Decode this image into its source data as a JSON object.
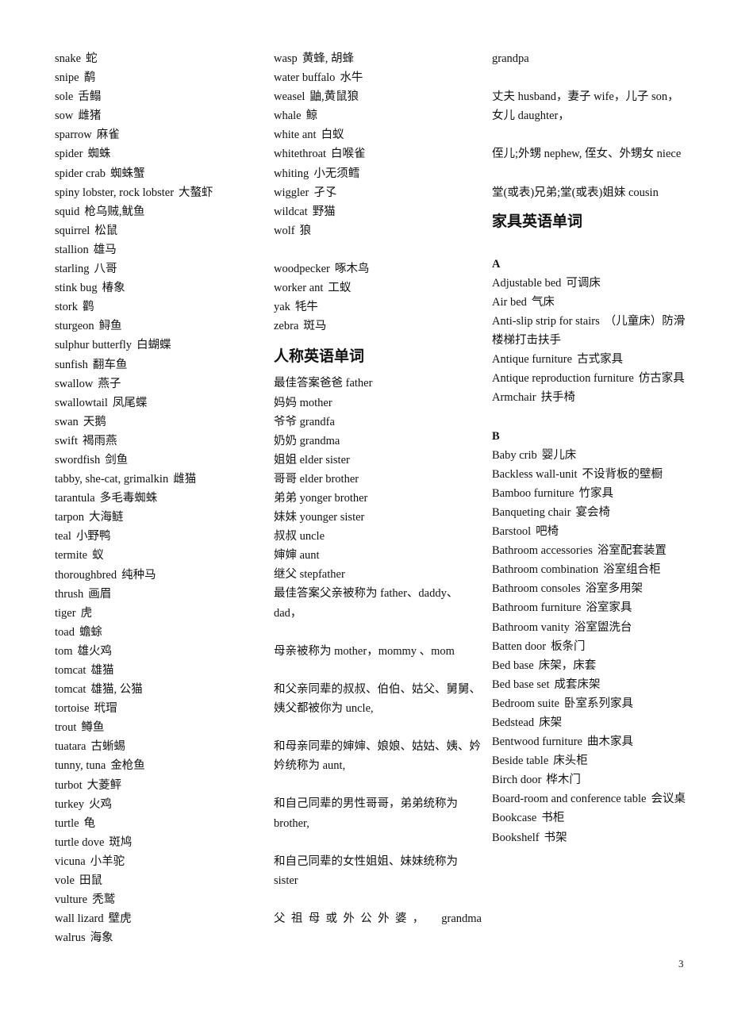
{
  "left_column": [
    {
      "en": "snake",
      "zh": "蛇"
    },
    {
      "en": "snipe",
      "zh": "鹬"
    },
    {
      "en": "sole",
      "zh": "舌鳎"
    },
    {
      "en": "sow",
      "zh": "雌猪"
    },
    {
      "en": "sparrow",
      "zh": "麻雀"
    },
    {
      "en": "spider",
      "zh": "蜘蛛"
    },
    {
      "en": "spider crab",
      "zh": "蜘蛛蟹"
    },
    {
      "en": "spiny lobster, rock lobster",
      "zh": "大螯虾"
    },
    {
      "en": "squid",
      "zh": "枪乌贼,鱿鱼"
    },
    {
      "en": "squirrel",
      "zh": "松鼠"
    },
    {
      "en": "stallion",
      "zh": "雄马"
    },
    {
      "en": "starling",
      "zh": "八哥"
    },
    {
      "en": "stink bug",
      "zh": "椿象"
    },
    {
      "en": "stork",
      "zh": "鹳"
    },
    {
      "en": "sturgeon",
      "zh": "鲟鱼"
    },
    {
      "en": "sulphur butterfly",
      "zh": "白蝴蝶"
    },
    {
      "en": "sunfish",
      "zh": "翻车鱼"
    },
    {
      "en": "swallow",
      "zh": "燕子"
    },
    {
      "en": "swallowtail",
      "zh": "凤尾蝶"
    },
    {
      "en": "swan",
      "zh": "天鹅"
    },
    {
      "en": "swift",
      "zh": "褐雨燕"
    },
    {
      "en": "swordfish",
      "zh": "剑鱼"
    },
    {
      "en": "tabby, she-cat, grimalkin",
      "zh": "雌猫"
    },
    {
      "en": "tarantula",
      "zh": "多毛毒蜘蛛"
    },
    {
      "en": "tarpon",
      "zh": "大海鲢"
    },
    {
      "en": "teal",
      "zh": "小野鸭"
    },
    {
      "en": "termite",
      "zh": "蚁"
    },
    {
      "en": "thoroughbred",
      "zh": "纯种马"
    },
    {
      "en": "thrush",
      "zh": "画眉"
    },
    {
      "en": "tiger",
      "zh": "虎"
    },
    {
      "en": "toad",
      "zh": "蟾蜍"
    },
    {
      "en": "tom",
      "zh": "雄火鸡"
    },
    {
      "en": "tomcat",
      "zh": "雄猫"
    },
    {
      "en": "tomcat",
      "zh": "雄猫, 公猫"
    },
    {
      "en": "tortoise",
      "zh": "玳瑁"
    },
    {
      "en": "trout",
      "zh": "鳟鱼"
    },
    {
      "en": "tuatara",
      "zh": "古蜥蜴"
    },
    {
      "en": "tunny, tuna",
      "zh": "金枪鱼"
    },
    {
      "en": "turbot",
      "zh": "大菱鲆"
    },
    {
      "en": "turkey",
      "zh": "火鸡"
    },
    {
      "en": "turtle",
      "zh": "龟"
    },
    {
      "en": "turtle dove",
      "zh": "斑鸠"
    },
    {
      "en": "vicuna",
      "zh": "小羊驼"
    },
    {
      "en": "vole",
      "zh": "田鼠"
    },
    {
      "en": "vulture",
      "zh": "秃鹫"
    },
    {
      "en": "wall lizard",
      "zh": "壁虎"
    },
    {
      "en": "walrus",
      "zh": "海象"
    }
  ],
  "middle_column": {
    "animals": [
      {
        "en": "wasp",
        "zh": "黄蜂, 胡蜂"
      },
      {
        "en": "water buffalo",
        "zh": "水牛"
      },
      {
        "en": "weasel",
        "zh": "鼬,黄鼠狼"
      },
      {
        "en": "whale",
        "zh": "鲸"
      },
      {
        "en": "white ant",
        "zh": "白蚁"
      },
      {
        "en": "whitethroat",
        "zh": "白喉雀"
      },
      {
        "en": "whiting",
        "zh": "小无须鳕"
      },
      {
        "en": "wiggler",
        "zh": "孑孓"
      },
      {
        "en": "wildcat",
        "zh": "野猫"
      },
      {
        "en": "wolf",
        "zh": "狼"
      }
    ],
    "animals_2": [
      {
        "en": "woodpecker",
        "zh": "啄木鸟"
      },
      {
        "en": "worker ant",
        "zh": "工蚁"
      },
      {
        "en": "yak",
        "zh": "牦牛"
      },
      {
        "en": "zebra",
        "zh": "斑马"
      }
    ],
    "people_heading": "人称英语单词",
    "people_list": [
      "最佳答案爸爸 father",
      "妈妈 mother",
      "爷爷 grandfa",
      "奶奶 grandma",
      "姐姐 elder sister",
      "哥哥 elder brother",
      "弟弟 yonger brother",
      "妹妹 younger sister",
      "叔叔 uncle",
      "婶婶 aunt",
      "继父 stepfather"
    ],
    "paragraphs": [
      "最佳答案父亲被称为 father、daddy、dad，",
      "母亲被称为 mother，mommy 、mom",
      "和父亲同辈的叔叔、伯伯、姑父、舅舅、姨父都被你为 uncle,",
      "和母亲同辈的婶婶、娘娘、姑姑、姨、妗妗统称为 aunt,",
      "和自己同辈的男性哥哥，弟弟统称为 brother,",
      "和自己同辈的女性姐姐、妹妹统称为 sister",
      "父祖母或外公外婆，　grandma"
    ]
  },
  "right_column": {
    "paragraphs": [
      "grandpa",
      "丈夫 husband，妻子 wife，儿子 son，女儿 daughter，",
      "侄儿;外甥 nephew, 侄女、外甥女 niece",
      "堂(或表)兄弟;堂(或表)姐妹  cousin"
    ],
    "furniture_heading": "家具英语单词",
    "section_a_letter": "A",
    "section_a": [
      {
        "en": "Adjustable bed",
        "zh": "可调床"
      },
      {
        "en": "Air bed",
        "zh": "气床"
      },
      {
        "en": "Anti-slip strip for stairs",
        "zh": "（儿童床）防滑楼梯打击扶手"
      },
      {
        "en": "Antique furniture",
        "zh": "古式家具"
      },
      {
        "en": "Antique reproduction furniture",
        "zh": "仿古家具"
      },
      {
        "en": "Armchair",
        "zh": "扶手椅"
      }
    ],
    "section_b_letter": "B",
    "section_b": [
      {
        "en": "Baby crib",
        "zh": "婴儿床"
      },
      {
        "en": "Backless wall-unit",
        "zh": "不设背板的壁橱"
      },
      {
        "en": "Bamboo furniture",
        "zh": "竹家具"
      },
      {
        "en": "Banqueting chair",
        "zh": "宴会椅"
      },
      {
        "en": "Barstool",
        "zh": "吧椅"
      },
      {
        "en": "Bathroom accessories",
        "zh": "浴室配套装置"
      },
      {
        "en": "Bathroom combination",
        "zh": "浴室组合柜"
      },
      {
        "en": "Bathroom consoles",
        "zh": "浴室多用架"
      },
      {
        "en": "Bathroom furniture",
        "zh": "浴室家具"
      },
      {
        "en": "Bathroom vanity",
        "zh": "浴室盥洗台"
      },
      {
        "en": "Batten door",
        "zh": "板条门"
      },
      {
        "en": "Bed base",
        "zh": "床架，床套"
      },
      {
        "en": "Bed base set",
        "zh": "成套床架"
      },
      {
        "en": "Bedroom suite",
        "zh": "卧室系列家具"
      },
      {
        "en": "Bedstead",
        "zh": "床架"
      },
      {
        "en": "Bentwood furniture",
        "zh": "曲木家具"
      },
      {
        "en": "Beside table",
        "zh": "床头柜"
      },
      {
        "en": "Birch door",
        "zh": "桦木门"
      },
      {
        "en": "Board-room and conference table",
        "zh": "会议桌"
      },
      {
        "en": "Bookcase",
        "zh": "书柜"
      },
      {
        "en": "Bookshelf",
        "zh": "书架"
      }
    ]
  },
  "page_number": "3"
}
